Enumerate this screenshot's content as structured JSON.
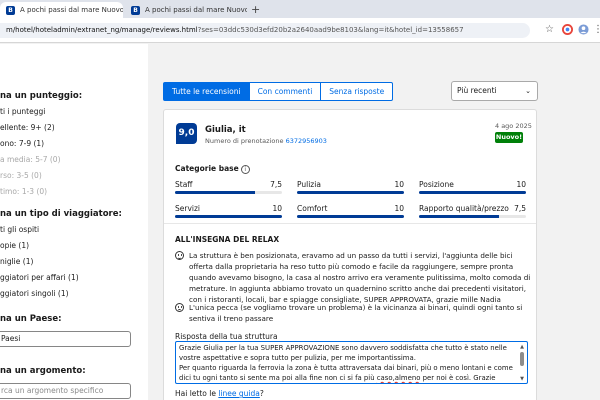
{
  "browser": {
    "tabs": [
      {
        "favicon": "B",
        "title": "A pochi passi dal mare Nuovo …"
      },
      {
        "favicon": "B",
        "title": "A pochi passi dal mare Nuovo …"
      }
    ],
    "new_tab": "+",
    "url_host": "m/hotel/hoteladmin/extranet_ng/manage/reviews.html",
    "url_query": "?ses=03ddc530d3efd20b2a2640aad9be8103&lang=it&hotel_id=13558657",
    "icons": [
      "star-icon",
      "extension-icon",
      "profile-icon",
      "menu-icon"
    ]
  },
  "filters": {
    "score_title": "na un punteggio:",
    "score_options": [
      {
        "label": "ti i punteggi",
        "enabled": true
      },
      {
        "label": "ellente: 9+ (2)",
        "enabled": true
      },
      {
        "label": "ono: 7-9 (1)",
        "enabled": true
      },
      {
        "label": "a media: 5-7 (0)",
        "enabled": false
      },
      {
        "label": "rso: 3-5 (0)",
        "enabled": false
      },
      {
        "label": "timo: 1-3 (0)",
        "enabled": false
      }
    ],
    "traveller_title": "na un tipo di viaggiatore:",
    "traveller_options": [
      {
        "label": "ti gli ospiti"
      },
      {
        "label": "opie (1)"
      },
      {
        "label": "niglie (1)"
      },
      {
        "label": "ggiatori per affari (1)"
      },
      {
        "label": "ggiatori singoli (1)"
      }
    ],
    "country_title": "na un Paese:",
    "country_value": "Paesi",
    "topic_title": "na un argomento:",
    "topic_placeholder": "rca un argomento specifico"
  },
  "main": {
    "tabs": [
      {
        "label": "Tutte le recensioni",
        "active": true
      },
      {
        "label": "Con commenti",
        "active": false
      },
      {
        "label": "Senza risposte",
        "active": false
      }
    ],
    "sort_label": "Più recenti",
    "review": {
      "score": "9,0",
      "guest": "Giulia, it",
      "booking_label": "Numero di prenotazione",
      "booking_number": "6372956903",
      "date": "4 ago 2025",
      "badge": "Nuovo!",
      "categories_title": "Categorie base",
      "categories": [
        {
          "label": "Staff",
          "value": "7,5",
          "fraction": 0.75
        },
        {
          "label": "Pulizia",
          "value": "10",
          "fraction": 1.0
        },
        {
          "label": "Posizione",
          "value": "10",
          "fraction": 1.0
        },
        {
          "label": "Servizi",
          "value": "10",
          "fraction": 1.0
        },
        {
          "label": "Comfort",
          "value": "10",
          "fraction": 1.0
        },
        {
          "label": "Rapporto qualità/prezzo",
          "value": "7,5",
          "fraction": 0.75
        }
      ],
      "headline": "ALL'INSEGNA DEL RELAX",
      "positive": "La struttura è ben posizionata, eravamo ad un passo da tutti i servizi, l'aggiunta delle bici offerta dalla proprietaria ha reso tutto più comodo e facile da raggiungere, sempre pronta quando avevamo bisogno, la casa al nostro arrivo era veramente pulitissima, molto comoda di metrature. In aggiunta abbiamo trovato un quadernino scritto anche dai precedenti visitatori, con i ristoranti, locali, bar e spiagge consigliate, SUPER APPROVATA, grazie mille Nadia",
      "negative": "L'unica pecca (se vogliamo trovare un problema) è la vicinanza ai binari, quindi ogni tanto si sentiva il treno passare",
      "reply_label": "Risposta della tua struttura",
      "reply_line1": "Grazie Giulia per la tua SUPER APPROVAZIONE sono davvero soddisfatta che tutto è stato nelle vostre aspettative e sopra tutto per pulizia, per me importantissima.",
      "reply_line2_a": "Per quanto riguarda la ferrovia la zona è tutta attraversata dai binari, più o meno lontani e come dici tu ogni tanto si sente ma poi alla fine non ci si fa più ",
      "reply_line2_b": "caso,almeno",
      "reply_line2_c": " per noi è così. Grazie ancora <3",
      "help_prefix": "Hai letto le ",
      "help_link": "linee guida",
      "help_suffix": "?"
    }
  }
}
